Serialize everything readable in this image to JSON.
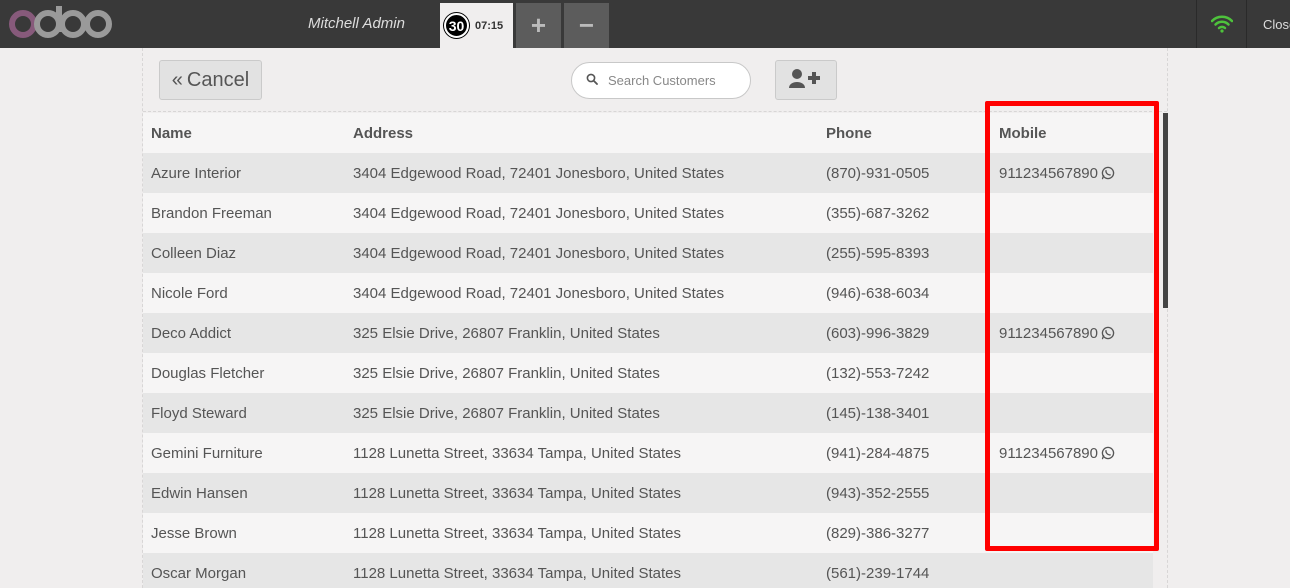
{
  "topbar": {
    "user_name": "Mitchell Admin",
    "order": {
      "number": "30",
      "time": "07:15"
    },
    "add_order_label": "+",
    "delete_order_label": "−",
    "close_label": "Close"
  },
  "colors": {
    "topbar": "#393939",
    "logo_o": "#875a7b",
    "wifi": "#4ec23c",
    "highlight": "#ff0000"
  },
  "header": {
    "cancel_label": "Cancel",
    "search_placeholder": "Search Customers"
  },
  "table": {
    "columns": [
      "Name",
      "Address",
      "Phone",
      "Mobile"
    ],
    "rows": [
      {
        "name": "Azure Interior",
        "address": "3404 Edgewood Road, 72401 Jonesboro, United States",
        "phone": "(870)-931-0505",
        "mobile": "911234567890"
      },
      {
        "name": "Brandon Freeman",
        "address": "3404 Edgewood Road, 72401 Jonesboro, United States",
        "phone": "(355)-687-3262",
        "mobile": ""
      },
      {
        "name": "Colleen Diaz",
        "address": "3404 Edgewood Road, 72401 Jonesboro, United States",
        "phone": "(255)-595-8393",
        "mobile": ""
      },
      {
        "name": "Nicole Ford",
        "address": "3404 Edgewood Road, 72401 Jonesboro, United States",
        "phone": "(946)-638-6034",
        "mobile": ""
      },
      {
        "name": "Deco Addict",
        "address": "325 Elsie Drive, 26807 Franklin, United States",
        "phone": "(603)-996-3829",
        "mobile": "911234567890"
      },
      {
        "name": "Douglas Fletcher",
        "address": "325 Elsie Drive, 26807 Franklin, United States",
        "phone": "(132)-553-7242",
        "mobile": ""
      },
      {
        "name": "Floyd Steward",
        "address": "325 Elsie Drive, 26807 Franklin, United States",
        "phone": "(145)-138-3401",
        "mobile": ""
      },
      {
        "name": "Gemini Furniture",
        "address": "1128 Lunetta Street, 33634 Tampa, United States",
        "phone": "(941)-284-4875",
        "mobile": "911234567890"
      },
      {
        "name": "Edwin Hansen",
        "address": "1128 Lunetta Street, 33634 Tampa, United States",
        "phone": "(943)-352-2555",
        "mobile": ""
      },
      {
        "name": "Jesse Brown",
        "address": "1128 Lunetta Street, 33634 Tampa, United States",
        "phone": "(829)-386-3277",
        "mobile": ""
      },
      {
        "name": "Oscar Morgan",
        "address": "1128 Lunetta Street, 33634 Tampa, United States",
        "phone": "(561)-239-1744",
        "mobile": ""
      }
    ]
  }
}
